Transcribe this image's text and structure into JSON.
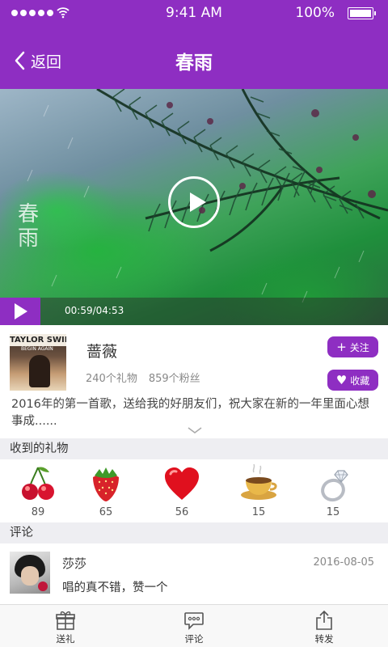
{
  "status_bar": {
    "time": "9:41 AM",
    "battery": "100%",
    "battery_level": 1.0,
    "signal_dots": 5
  },
  "nav": {
    "back_label": "返回",
    "title": "春雨"
  },
  "video": {
    "overlay_text": "春雨",
    "time": "00:59/04:53",
    "progress": 0.2
  },
  "artist": {
    "name": "蔷薇",
    "gifts_count": "240个礼物",
    "fans_count": "859个粉丝",
    "follow_label": "关注",
    "favorite_label": "收藏",
    "album_title": "TAYLOR SWIFT",
    "album_subtitle": "BEGIN AGAIN"
  },
  "description": "2016年的第一首歌，送给我的好朋友们，祝大家在新的一年里面心想事成......",
  "gifts": {
    "header": "收到的礼物",
    "items": [
      {
        "name": "cherry",
        "count": "89"
      },
      {
        "name": "strawberry",
        "count": "65"
      },
      {
        "name": "heart",
        "count": "56"
      },
      {
        "name": "coffee",
        "count": "15"
      },
      {
        "name": "ring",
        "count": "15"
      }
    ]
  },
  "comments": {
    "header": "评论",
    "items": [
      {
        "user": "莎莎",
        "date": "2016-08-05",
        "text": "唱的真不错，赞一个"
      }
    ]
  },
  "tabs": [
    {
      "label": "送礼",
      "icon": "gift-icon"
    },
    {
      "label": "评论",
      "icon": "comment-icon"
    },
    {
      "label": "转发",
      "icon": "share-icon"
    }
  ],
  "colors": {
    "accent": "#8e2ec2",
    "section_bg": "#eeeef2"
  }
}
